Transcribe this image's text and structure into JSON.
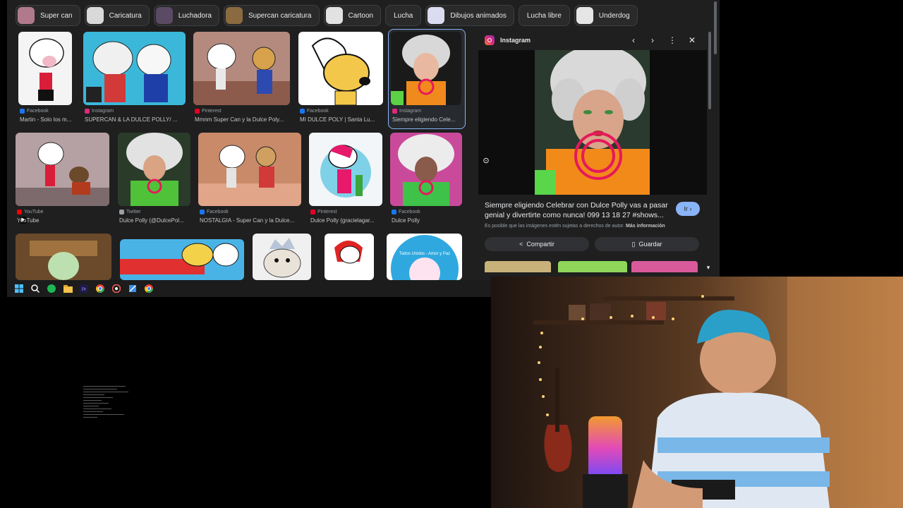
{
  "chips": [
    {
      "label": "Super can",
      "thumb": "#b07a8c"
    },
    {
      "label": "Caricatura",
      "thumb": "#d9d9d9"
    },
    {
      "label": "Luchadora",
      "thumb": "#5a4a63"
    },
    {
      "label": "Supercan caricatura",
      "thumb": "#8b6a3f"
    },
    {
      "label": "Cartoon",
      "thumb": "#e2e2e2"
    },
    {
      "label": "Lucha",
      "thumb": null
    },
    {
      "label": "Dibujos animados",
      "thumb": "#dcdcf0"
    },
    {
      "label": "Lucha libre",
      "thumb": null
    },
    {
      "label": "Underdog",
      "thumb": "#e5e5e5"
    }
  ],
  "results": [
    {
      "source": "Facebook",
      "title": "Martin - Solo los m...",
      "src_color": "#1877f2"
    },
    {
      "source": "Instagram",
      "title": "SUPERCAN & LA DULCE POLLY/ ...",
      "src_color": "#dd2a7b"
    },
    {
      "source": "Pinterest",
      "title": "Mmnm Super Can y la Dulce Poly...",
      "src_color": "#e60023"
    },
    {
      "source": "Facebook",
      "title": "MI DULCE POLY | Santa Lu...",
      "src_color": "#1877f2"
    },
    {
      "source": "Instagram",
      "title": "Siempre eligiendo Cele...",
      "src_color": "#dd2a7b"
    },
    {
      "source": "YouTube",
      "title": "YouTube",
      "src_color": "#ff0000"
    },
    {
      "source": "Twitter",
      "title": "Dulce Polly (@DulcePol...",
      "src_color": "#9aa0a6"
    },
    {
      "source": "Facebook",
      "title": "NOSTALGIA - Super Can y la Dulce...",
      "src_color": "#1877f2"
    },
    {
      "source": "Pinterest",
      "title": "Dulce Polly (gracielagar...",
      "src_color": "#e60023"
    },
    {
      "source": "Facebook",
      "title": "Dulce Polly",
      "src_color": "#1877f2"
    }
  ],
  "thumb_caption_3_2": "Todos Unidos - Amor y Paz",
  "panel": {
    "brand": "Instagram",
    "title": "Siempre eligiendo Celebrar con Dulce Polly vas a pasar genial y divertirte como nunca! 099 13 18 27 #shows...",
    "visit_label": "Ir",
    "copyright": "Es posible que las imágenes estén sujetas a derechos de autor.",
    "more_info": "Más información",
    "share_label": "Compartir",
    "save_label": "Guardar"
  },
  "icons": {
    "prev": "chevron-left-icon",
    "next": "chevron-right-icon",
    "more": "more-vert-icon",
    "close": "close-icon",
    "lens": "lens-icon",
    "share": "share-icon",
    "bookmark": "bookmark-icon"
  },
  "taskbar": [
    "windows-start-icon",
    "search-icon",
    "spotify-icon",
    "file-explorer-icon",
    "premiere-icon",
    "chrome-icon",
    "browser-icon",
    "snipping-tool-icon",
    "chrome-active-icon"
  ],
  "colors": {
    "accent": "#8ab4f8",
    "panel_bg": "#1f1f1f",
    "chip_border": "#3c4043"
  }
}
